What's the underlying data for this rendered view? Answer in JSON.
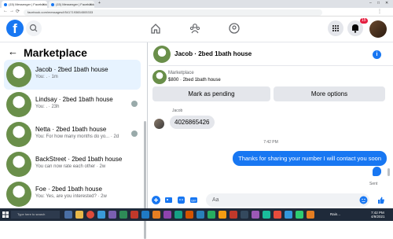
{
  "browser": {
    "tabs": [
      {
        "title": "(15) Messenger | Facebook",
        "active": true
      },
      {
        "title": "(15) Messenger | Facebook",
        "active": false
      }
    ],
    "url": "facebook.com/messages/t/5417193654505333"
  },
  "header": {
    "logo_letter": "f",
    "notifications_badge": "15"
  },
  "sidebar": {
    "title": "Marketplace",
    "conversations": [
      {
        "name": "Jacob · 2bed 1bath house",
        "preview": "You: . · 1m",
        "active": true
      },
      {
        "name": "Lindsay · 2bed 1bath house",
        "preview": "You: . · 23h",
        "active": false
      },
      {
        "name": "Netta · 2bed 1bath house",
        "preview": "You: For how many months do yo... · 2d",
        "active": false
      },
      {
        "name": "BackStreet · 2bed 1bath house",
        "preview": "You can now rate each other · 2w",
        "active": false
      },
      {
        "name": "Foe · 2bed 1bath house",
        "preview": "You: Yes, are you interested? · 2w",
        "active": false
      }
    ]
  },
  "chat": {
    "title": "Jacob · 2bed 1bath house",
    "marketplace_label": "Marketplace",
    "listing": "$800 · 2bed 1bath house",
    "mark_pending_label": "Mark as pending",
    "more_options_label": "More options",
    "sender_name": "Jacob",
    "incoming_message": "4026865426",
    "timestamp": "7:42 PM",
    "outgoing_message": "Thanks for sharing your number I will contact you soon",
    "sent_label": "Sent",
    "composer_placeholder": "Aa"
  },
  "taskbar": {
    "search_placeholder": "Type here to search",
    "weather": "Rain...",
    "time": "7:42 PM",
    "date": "4/9/2021"
  },
  "colors": {
    "facebook_blue": "#1877f2",
    "active_conversation": "#e7f3ff",
    "notification_red": "#e41e3f"
  }
}
